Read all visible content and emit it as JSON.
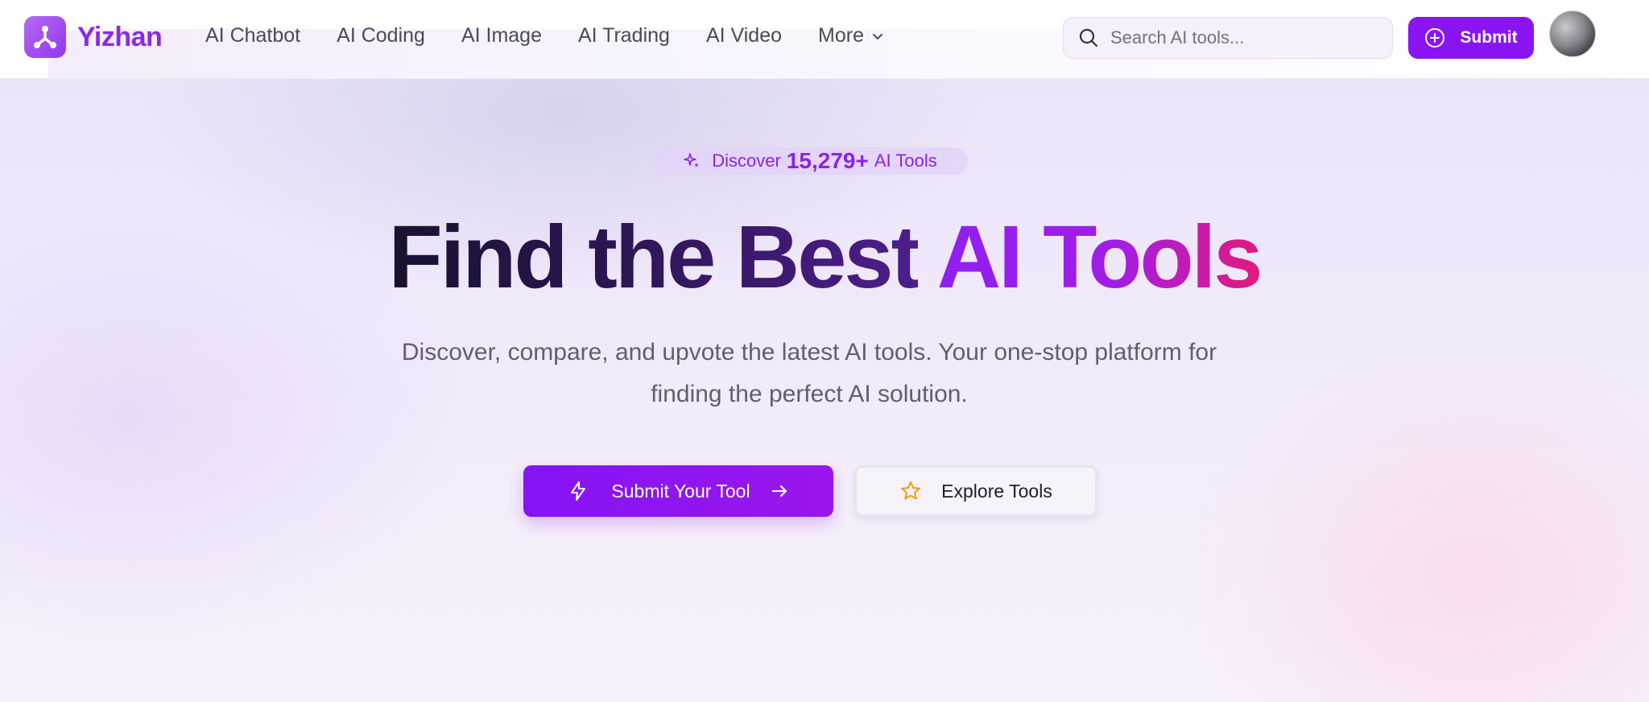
{
  "brand": {
    "name": "Yizhan",
    "logo_icon": "hub-icon"
  },
  "nav": {
    "items": [
      {
        "label": "AI Chatbot"
      },
      {
        "label": "AI Coding"
      },
      {
        "label": "AI Image"
      },
      {
        "label": "AI Trading"
      },
      {
        "label": "AI Video"
      },
      {
        "label": "More",
        "icon": "chevron-down-icon"
      }
    ]
  },
  "search": {
    "placeholder": "Search AI tools...",
    "value": "",
    "icon": "search-icon"
  },
  "header_submit": {
    "label": "Submit",
    "icon": "plus-circle-icon"
  },
  "badge": {
    "prefix": "Discover",
    "count": "15,279+",
    "suffix": "AI Tools",
    "icon": "sparkles-icon"
  },
  "hero": {
    "headline_main": "Find the Best",
    "headline_accent": "AI Tools",
    "subtitle_line1": "Discover, compare, and upvote the latest AI tools. Your one-stop platform for",
    "subtitle_line2": "finding the perfect AI solution."
  },
  "cta": {
    "primary": {
      "label": "Submit Your Tool",
      "icon": "lightning-icon",
      "trailing_icon": "arrow-right-icon"
    },
    "secondary": {
      "label": "Explore Tools",
      "icon": "star-icon"
    }
  },
  "colors": {
    "brand": "#8a2be2",
    "primary_button": "#8b14f4",
    "accent_gradient_end": "#e21a7c",
    "star": "#f0a020"
  }
}
